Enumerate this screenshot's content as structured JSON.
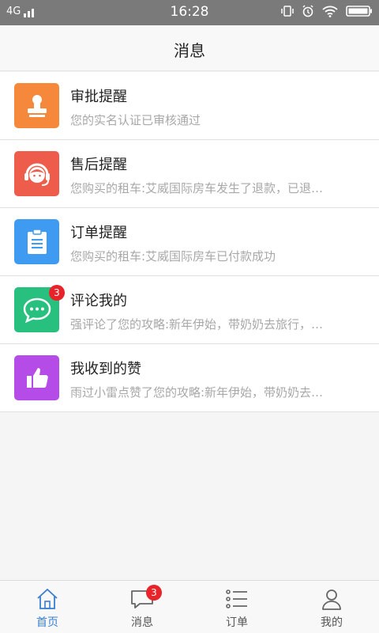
{
  "status_bar": {
    "network": "4G",
    "time": "16:28"
  },
  "header": {
    "title": "消息"
  },
  "messages": [
    {
      "title": "审批提醒",
      "preview": "您的实名认证已审核通过",
      "icon": "stamp-icon",
      "color": "#f5883a",
      "badge": null
    },
    {
      "title": "售后提醒",
      "preview": "您购买的租车:艾威国际房车发生了退款，已退…",
      "icon": "customer-service-icon",
      "color": "#ee5d4c",
      "badge": null
    },
    {
      "title": "订单提醒",
      "preview": "您购买的租车:艾威国际房车已付款成功",
      "icon": "clipboard-icon",
      "color": "#3f9bf1",
      "badge": null
    },
    {
      "title": "评论我的",
      "preview": "强评论了您的攻略:新年伊始，带奶奶去旅行，…",
      "icon": "chat-bubble-icon",
      "color": "#27c07e",
      "badge": "3"
    },
    {
      "title": "我收到的赞",
      "preview": "雨过小雷点赞了您的攻略:新年伊始，带奶奶去…",
      "icon": "thumbs-up-icon",
      "color": "#b64ce8",
      "badge": null
    }
  ],
  "tabbar": {
    "tabs": [
      {
        "label": "首页",
        "icon": "home-icon",
        "active": true
      },
      {
        "label": "消息",
        "icon": "message-icon",
        "badge": "3"
      },
      {
        "label": "订单",
        "icon": "list-icon"
      },
      {
        "label": "我的",
        "icon": "person-icon"
      }
    ],
    "active_color": "#3a7fd0"
  }
}
